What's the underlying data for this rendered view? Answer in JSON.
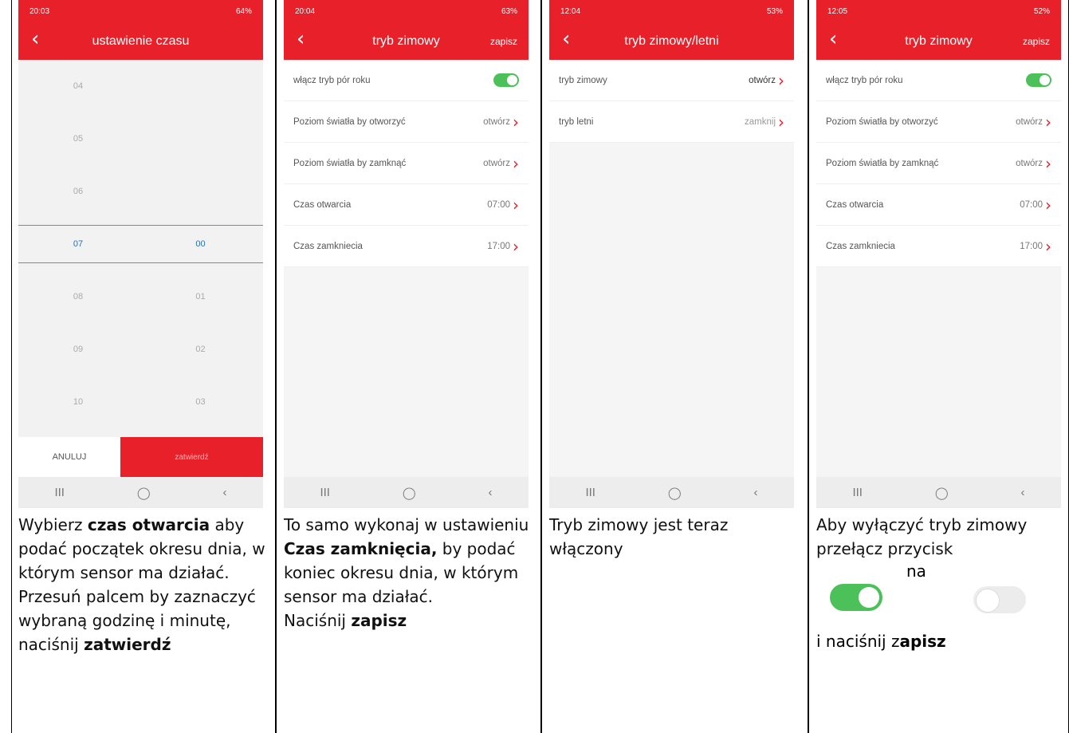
{
  "panel1": {
    "status_time": "20:03",
    "status_battery": "64%",
    "title": "ustawienie czasu",
    "picker_rows": [
      {
        "h": "04",
        "m": ""
      },
      {
        "h": "05",
        "m": ""
      },
      {
        "h": "06",
        "m": ""
      }
    ],
    "picker_selected": {
      "h": "07",
      "m": "00"
    },
    "picker_rows_after": [
      {
        "h": "08",
        "m": "01"
      },
      {
        "h": "09",
        "m": "02"
      },
      {
        "h": "10",
        "m": "03"
      }
    ],
    "cancel_label": "ANULUJ",
    "confirm_label": "zatwierdź",
    "caption": {
      "t1": "Wybierz ",
      "b1": "czas otwarcia",
      "t2": " aby podać początek okresu dnia, w którym sensor ma działać. Przesuń palcem by zaznaczyć wybraną godzinę i minutę, naciśnij ",
      "b2": "zatwierdź"
    }
  },
  "panel2": {
    "status_time": "20:04",
    "status_battery": "63%",
    "title": "tryb zimowy",
    "save_label": "zapisz",
    "rows": [
      {
        "label": "włącz tryb pór roku",
        "value": ""
      },
      {
        "label": "Poziom światła by otworzyć",
        "value": "otwórz"
      },
      {
        "label": "Poziom światła by zamknąć",
        "value": "otwórz"
      },
      {
        "label": "Czas otwarcia",
        "value": "07:00"
      },
      {
        "label": "Czas zamkniecia",
        "value": "17:00"
      }
    ],
    "caption": {
      "t1": "To samo wykonaj w ustawieniu ",
      "b1": "Czas zamknięcia,",
      "t2": " by podać koniec okresu dnia, w którym sensor ma działać.",
      "t3": "Naciśnij ",
      "b2": "zapisz"
    }
  },
  "panel3": {
    "status_time": "12:04",
    "status_battery": "53%",
    "title": "tryb zimowy/letni",
    "rows": [
      {
        "label": "tryb zimowy",
        "value": "otwórz"
      },
      {
        "label": "tryb letni",
        "value": "zamknij"
      }
    ],
    "caption": "Tryb zimowy jest teraz włączony"
  },
  "panel4": {
    "status_time": "12:05",
    "status_battery": "52%",
    "title": "tryb zimowy",
    "save_label": "zapisz",
    "rows": [
      {
        "label": "włącz tryb pór roku",
        "value": ""
      },
      {
        "label": "Poziom światła by otworzyć",
        "value": "otwórz"
      },
      {
        "label": "Poziom światła by zamknąć",
        "value": "otwórz"
      },
      {
        "label": "Czas otwarcia",
        "value": "07:00"
      },
      {
        "label": "Czas zamkniecia",
        "value": "17:00"
      }
    ],
    "caption": {
      "t1": "Aby wyłączyć tryb zimowy przełącz przycisk",
      "t2": "na",
      "t3": "i naciśnij z",
      "b1": "apisz"
    }
  },
  "nav": {
    "recent": "III",
    "home": "◯",
    "back": "‹"
  },
  "colors": {
    "brand": "#e8202a",
    "toggle_on": "#4cc15a",
    "picker_selected": "#2a6fb5"
  }
}
